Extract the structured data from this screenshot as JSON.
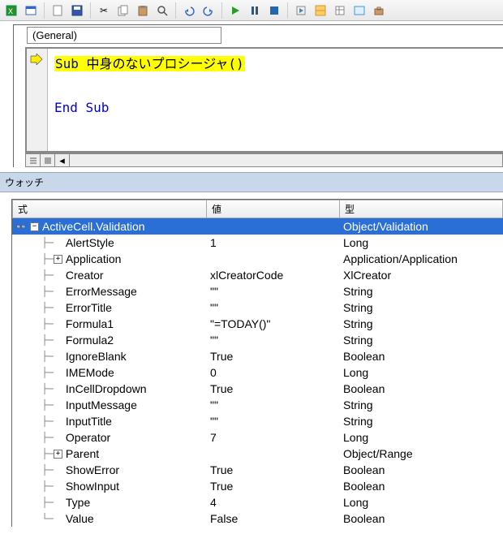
{
  "toolbar_icons": [
    "excel",
    "view",
    "new",
    "open",
    "save",
    "cut",
    "copy",
    "paste",
    "find",
    "undo",
    "redo",
    "run",
    "pause",
    "stop",
    "step",
    "design",
    "props",
    "browser",
    "toolbox"
  ],
  "general_label": "(General)",
  "code": {
    "line1_kw": "Sub",
    "line1_rest": " 中身のないプロシージャ()",
    "end_kw": "End Sub"
  },
  "watch_title": "ウォッチ",
  "watch_headers": {
    "expr": "式",
    "val": "値",
    "type": "型"
  },
  "watch_root": {
    "expr": "ActiveCell.Validation",
    "val": "",
    "type": "Object/Validation"
  },
  "watch_children": [
    {
      "expand": "",
      "name": "AlertStyle",
      "val": "1",
      "type": "Long"
    },
    {
      "expand": "+",
      "name": "Application",
      "val": "",
      "type": "Application/Application"
    },
    {
      "expand": "",
      "name": "Creator",
      "val": "xlCreatorCode",
      "type": "XlCreator"
    },
    {
      "expand": "",
      "name": "ErrorMessage",
      "val": "\"\"",
      "type": "String"
    },
    {
      "expand": "",
      "name": "ErrorTitle",
      "val": "\"\"",
      "type": "String"
    },
    {
      "expand": "",
      "name": "Formula1",
      "val": "\"=TODAY()\"",
      "type": "String"
    },
    {
      "expand": "",
      "name": "Formula2",
      "val": "\"\"",
      "type": "String"
    },
    {
      "expand": "",
      "name": "IgnoreBlank",
      "val": "True",
      "type": "Boolean"
    },
    {
      "expand": "",
      "name": "IMEMode",
      "val": "0",
      "type": "Long"
    },
    {
      "expand": "",
      "name": "InCellDropdown",
      "val": "True",
      "type": "Boolean"
    },
    {
      "expand": "",
      "name": "InputMessage",
      "val": "\"\"",
      "type": "String"
    },
    {
      "expand": "",
      "name": "InputTitle",
      "val": "\"\"",
      "type": "String"
    },
    {
      "expand": "",
      "name": "Operator",
      "val": "7",
      "type": "Long"
    },
    {
      "expand": "+",
      "name": "Parent",
      "val": "",
      "type": "Object/Range"
    },
    {
      "expand": "",
      "name": "ShowError",
      "val": "True",
      "type": "Boolean"
    },
    {
      "expand": "",
      "name": "ShowInput",
      "val": "True",
      "type": "Boolean"
    },
    {
      "expand": "",
      "name": "Type",
      "val": "4",
      "type": "Long"
    },
    {
      "expand": "",
      "name": "Value",
      "val": "False",
      "type": "Boolean"
    }
  ]
}
